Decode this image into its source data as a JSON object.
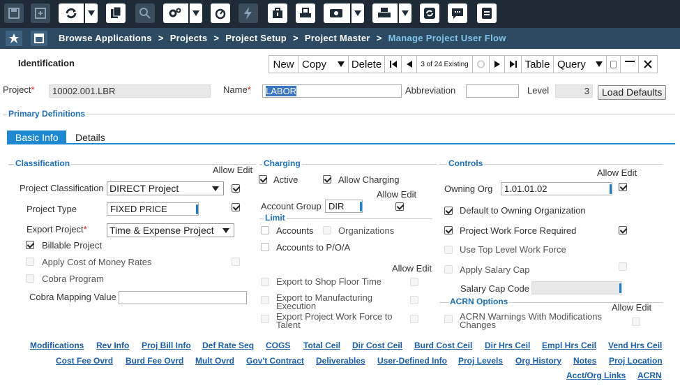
{
  "toolbar": {
    "icons": [
      "save-icon",
      "save-as-icon",
      "refresh-icon",
      "copy-icon",
      "search-icon",
      "settings-icon",
      "timer-icon",
      "lightning-icon",
      "tools-icon",
      "print-preview-icon",
      "view-icon",
      "print-icon",
      "sync-icon",
      "comment-icon",
      "document-icon"
    ],
    "colors": {
      "bg": "#1e2a35",
      "button": "#ffffff",
      "disabled": "#3a4d5e"
    }
  },
  "breadcrumb": {
    "items": [
      "Browse Applications",
      "Projects",
      "Project Setup",
      "Project Master"
    ],
    "current": "Manage Project User Flow",
    "separator": ">"
  },
  "identification": {
    "title": "Identification",
    "buttons": {
      "new": "New",
      "copy": "Copy",
      "delete": "Delete",
      "record_status": "3 of 24 Existing",
      "table": "Table",
      "query": "Query"
    }
  },
  "header_fields": {
    "project_label": "Project",
    "project_value": "10002.001.LBR",
    "name_label": "Name",
    "name_value": "LABOR",
    "abbreviation_label": "Abbreviation",
    "abbreviation_value": "",
    "level_label": "Level",
    "level_value": "3",
    "load_defaults": "Load Defaults"
  },
  "primary_definitions": "Primary Definitions",
  "tabs": [
    "Basic Info",
    "Details"
  ],
  "classification": {
    "title": "Classification",
    "allow_edit": "Allow Edit",
    "project_classification_label": "Project Classification",
    "project_classification_value": "DIRECT Project",
    "project_type_label": "Project Type",
    "project_type_value": "FIXED PRICE",
    "export_project_label": "Export Project",
    "export_project_value": "Time & Expense Project",
    "billable_project": "Billable Project",
    "apply_cost_of_money": "Apply Cost of Money Rates",
    "cobra_program": "Cobra Program",
    "cobra_mapping_label": "Cobra Mapping Value",
    "cobra_mapping_value": ""
  },
  "charging": {
    "title": "Charging",
    "active": "Active",
    "allow_charging": "Allow Charging",
    "allow_edit": "Allow Edit",
    "account_group_label": "Account Group",
    "account_group_value": "DIR",
    "limit_title": "Limit",
    "accounts": "Accounts",
    "organizations": "Organizations",
    "accounts_to_poa": "Accounts to P/O/A",
    "allow_edit_2": "Allow Edit",
    "export_shop_floor": "Export to Shop Floor Time",
    "export_manufacturing_1": "Export to Manufacturing",
    "export_manufacturing_2": "Execution",
    "export_work_force_1": "Export Project Work Force to",
    "export_work_force_2": "Talent"
  },
  "controls": {
    "title": "Controls",
    "allow_edit": "Allow Edit",
    "owning_org_label": "Owning Org",
    "owning_org_value": "1.01.01.02",
    "default_to_owning": "Default to Owning Organization",
    "work_force_required": "Project Work Force Required",
    "use_top_level": "Use Top Level Work Force",
    "apply_salary_cap": "Apply Salary Cap",
    "salary_cap_code_label": "Salary Cap Code",
    "salary_cap_code_value": "",
    "acrn_title": "ACRN Options",
    "allow_edit_2": "Allow Edit",
    "acrn_warnings_1": "ACRN Warnings With Modifications",
    "acrn_warnings_2": "Changes"
  },
  "checkbox_states": {
    "class_allow_edit": true,
    "type_allow_edit": true,
    "billable_project": true,
    "apply_cost_of_money": false,
    "cost_money_allow_edit": false,
    "cobra_program": false,
    "active": true,
    "allow_charging": true,
    "account_group_allow_edit": true,
    "accounts": false,
    "organizations": false,
    "accounts_to_poa": false,
    "export_shop_floor": false,
    "export_shop_floor_allow_edit": false,
    "export_manufacturing": false,
    "export_manufacturing_allow_edit": false,
    "export_work_force": false,
    "export_work_force_allow_edit": false,
    "owning_org_allow_edit": true,
    "default_to_owning": true,
    "work_force_required": true,
    "work_force_allow_edit": true,
    "use_top_level": false,
    "apply_salary_cap": false,
    "salary_cap_allow_edit": false,
    "acrn_warnings": false,
    "acrn_allow_edit": false
  },
  "links": {
    "row1": [
      "Modifications",
      "Rev Info",
      "Proj Bill Info",
      "Def Rate Seq",
      "COGS",
      "Total Ceil",
      "Dir Cost Ceil",
      "Burd Cost Ceil",
      "Dir Hrs Ceil",
      "Empl Hrs Ceil",
      "Vend Hrs Ceil"
    ],
    "row2": [
      "Cost Fee Ovrd",
      "Burd Fee Ovrd",
      "Mult Ovrd",
      "Gov't Contract",
      "Deliverables",
      "User-Defined Info",
      "Proj Levels",
      "Org History",
      "Notes",
      "Proj Location"
    ],
    "row3": [
      "Acct/Org Links",
      "ACRN"
    ]
  }
}
